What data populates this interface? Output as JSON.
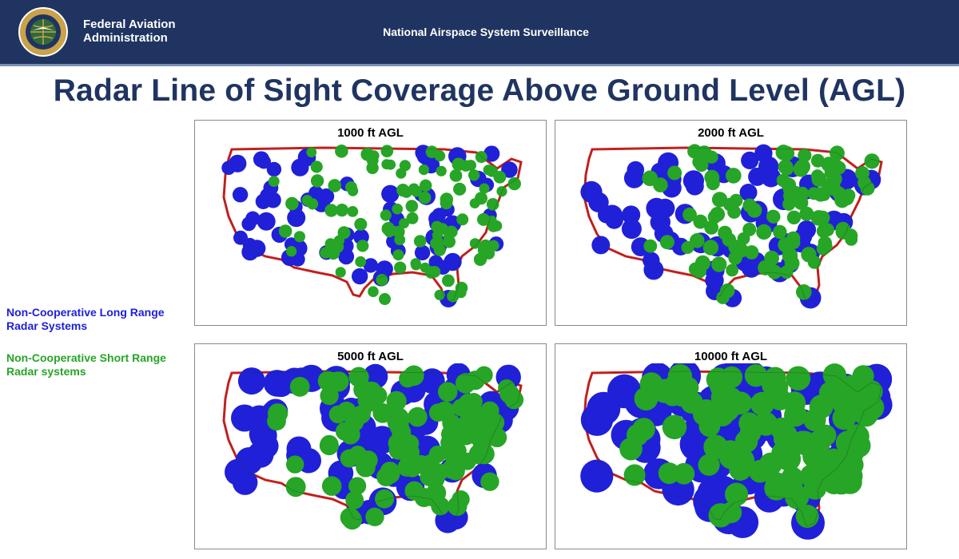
{
  "header": {
    "org_name_line1": "Federal Aviation",
    "org_name_line2": "Administration",
    "title": "National Airspace System Surveillance",
    "seal_text": "FEDERAL AVIATION ADMINISTRATION"
  },
  "page_title": "Radar Line of Sight Coverage Above Ground Level (AGL)",
  "legend": {
    "long_range": "Non-Cooperative Long Range Radar Systems",
    "short_range": "Non-Cooperative Short Range Radar systems"
  },
  "panels": [
    {
      "title": "1000 ft AGL",
      "coverage": 0.22
    },
    {
      "title": "2000 ft AGL",
      "coverage": 0.35
    },
    {
      "title": "5000 ft AGL",
      "coverage": 0.62
    },
    {
      "title": "10000 ft AGL",
      "coverage": 0.85
    }
  ],
  "colors": {
    "header_bg": "#1f3461",
    "title": "#1f3461",
    "long_range": "#2020d8",
    "short_range": "#26a526",
    "border_line": "#d42020"
  }
}
